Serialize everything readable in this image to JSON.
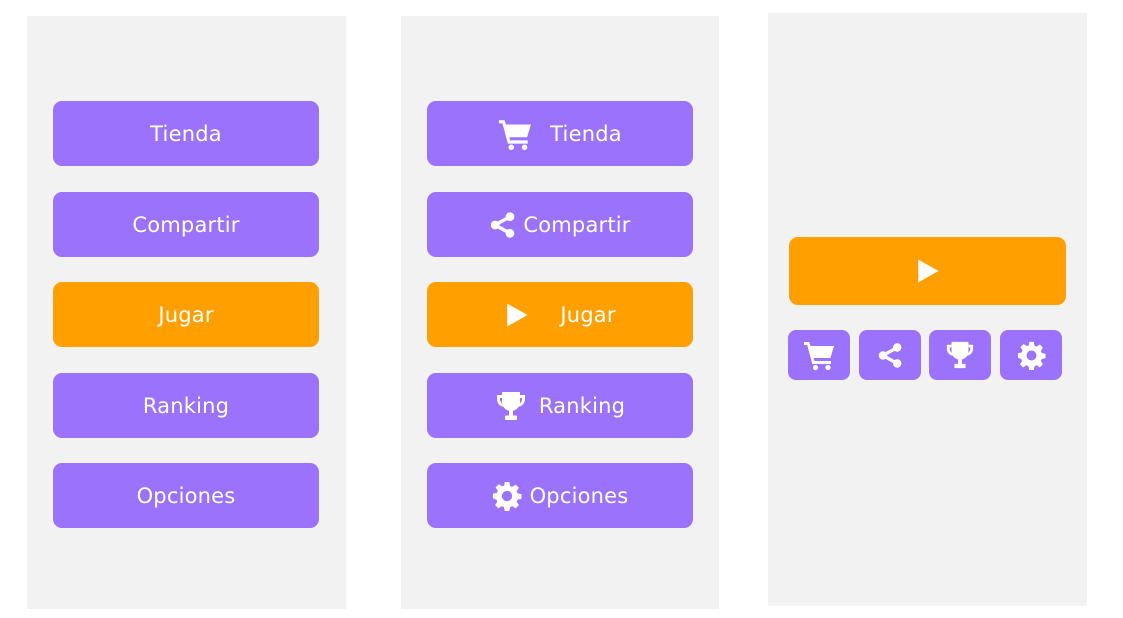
{
  "colors": {
    "purple": "#9b72fb",
    "orange": "#ffa000",
    "panel_bg": "#f2f2f2"
  },
  "panel_text_only": {
    "buttons": [
      {
        "label": "Tienda",
        "style": "purple"
      },
      {
        "label": "Compartir",
        "style": "purple"
      },
      {
        "label": "Jugar",
        "style": "orange"
      },
      {
        "label": "Ranking",
        "style": "purple"
      },
      {
        "label": "Opciones",
        "style": "purple"
      }
    ]
  },
  "panel_with_icons": {
    "buttons": [
      {
        "label": "Tienda",
        "icon": "cart-icon",
        "style": "purple"
      },
      {
        "label": "Compartir",
        "icon": "share-icon",
        "style": "purple"
      },
      {
        "label": "Jugar",
        "icon": "play-icon",
        "style": "orange"
      },
      {
        "label": "Ranking",
        "icon": "trophy-icon",
        "style": "purple"
      },
      {
        "label": "Opciones",
        "icon": "gear-icon",
        "style": "purple"
      }
    ]
  },
  "panel_icons_only": {
    "play_icon": "play-icon",
    "icon_buttons": [
      "cart-icon",
      "share-icon",
      "trophy-icon",
      "gear-icon"
    ]
  }
}
